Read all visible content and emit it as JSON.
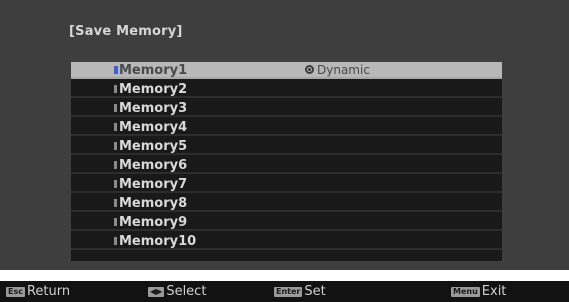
{
  "dialog": {
    "title": "[Save Memory]"
  },
  "list": {
    "items": [
      {
        "label": "Memory1",
        "status": "Dynamic"
      },
      {
        "label": "Memory2",
        "status": ""
      },
      {
        "label": "Memory3",
        "status": ""
      },
      {
        "label": "Memory4",
        "status": ""
      },
      {
        "label": "Memory5",
        "status": ""
      },
      {
        "label": "Memory6",
        "status": ""
      },
      {
        "label": "Memory7",
        "status": ""
      },
      {
        "label": "Memory8",
        "status": ""
      },
      {
        "label": "Memory9",
        "status": ""
      },
      {
        "label": "Memory10",
        "status": ""
      }
    ],
    "selected_index": 0
  },
  "footer": {
    "hints": [
      {
        "key": "Esc",
        "label": "Return"
      },
      {
        "key": "◀▶",
        "label": "Select"
      },
      {
        "key": "Enter",
        "label": "Set"
      },
      {
        "key": "Menu",
        "label": "Exit"
      }
    ]
  },
  "colors": {
    "screen_background": "#3e3e3e",
    "list_background": "#191919",
    "selected_row": "#b8b8b8",
    "selected_marker": "#3c5fd8",
    "footer_background": "#121212"
  }
}
